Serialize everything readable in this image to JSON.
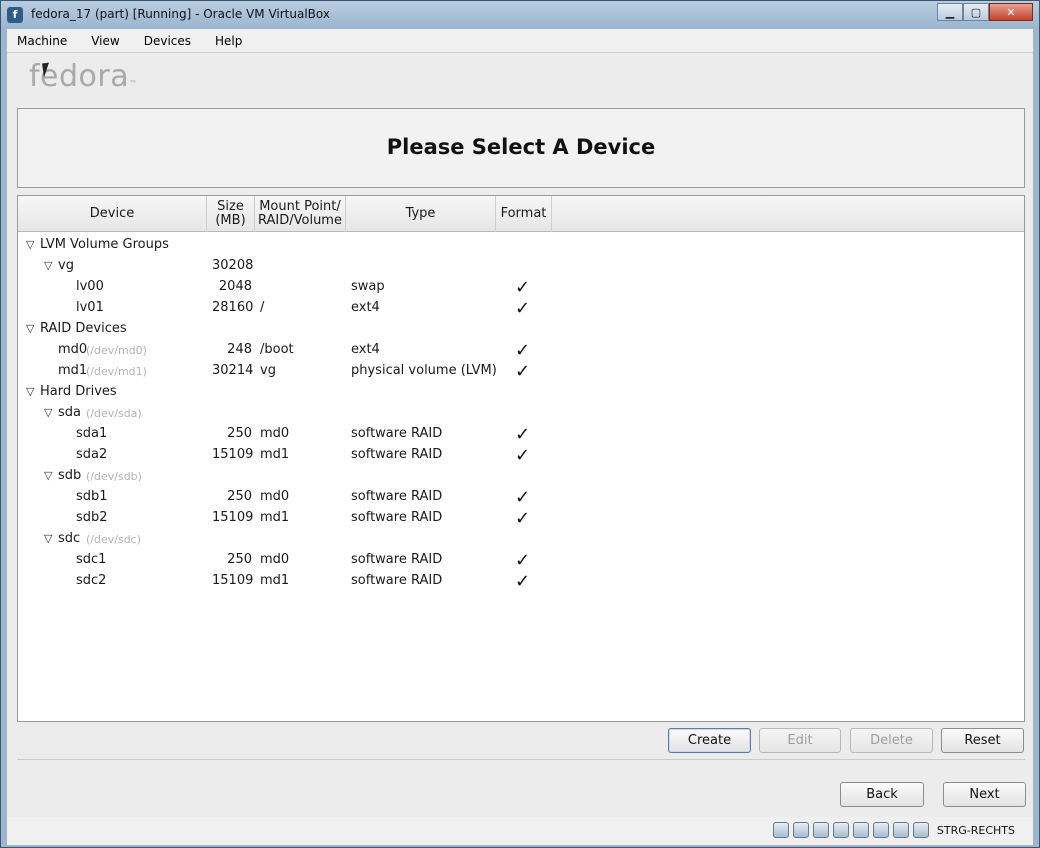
{
  "window": {
    "title": "fedora_17 (part) [Running] - Oracle VM VirtualBox"
  },
  "menu": [
    "Machine",
    "View",
    "Devices",
    "Help"
  ],
  "logo": "fedora",
  "header": {
    "title": "Please Select A Device"
  },
  "columns": {
    "device": "Device",
    "size": "Size\n(MB)",
    "mount": "Mount Point/\nRAID/Volume",
    "type": "Type",
    "format": "Format"
  },
  "rows": [
    {
      "level": 0,
      "expander": true,
      "device": "LVM Volume Groups",
      "path": "",
      "size": "",
      "mount": "",
      "type": "",
      "format": false
    },
    {
      "level": 1,
      "expander": true,
      "device": "vg",
      "path": "",
      "size": "30208",
      "mount": "",
      "type": "",
      "format": false
    },
    {
      "level": 2,
      "expander": false,
      "device": "lv00",
      "path": "",
      "size": "2048",
      "mount": "",
      "type": "swap",
      "format": true
    },
    {
      "level": 2,
      "expander": false,
      "device": "lv01",
      "path": "",
      "size": "28160",
      "mount": "/",
      "type": "ext4",
      "format": true
    },
    {
      "level": 0,
      "expander": true,
      "device": "RAID Devices",
      "path": "",
      "size": "",
      "mount": "",
      "type": "",
      "format": false
    },
    {
      "level": 1,
      "expander": false,
      "device": "md0",
      "path": "(/dev/md0)",
      "size": "248",
      "mount": "/boot",
      "type": "ext4",
      "format": true
    },
    {
      "level": 1,
      "expander": false,
      "device": "md1",
      "path": "(/dev/md1)",
      "size": "30214",
      "mount": "vg",
      "type": "physical volume (LVM)",
      "format": true
    },
    {
      "level": 0,
      "expander": true,
      "device": "Hard Drives",
      "path": "",
      "size": "",
      "mount": "",
      "type": "",
      "format": false
    },
    {
      "level": 1,
      "expander": true,
      "device": "sda",
      "path": "(/dev/sda)",
      "size": "",
      "mount": "",
      "type": "",
      "format": false
    },
    {
      "level": 2,
      "expander": false,
      "device": "sda1",
      "path": "",
      "size": "250",
      "mount": "md0",
      "type": "software RAID",
      "format": true
    },
    {
      "level": 2,
      "expander": false,
      "device": "sda2",
      "path": "",
      "size": "15109",
      "mount": "md1",
      "type": "software RAID",
      "format": true
    },
    {
      "level": 1,
      "expander": true,
      "device": "sdb",
      "path": "(/dev/sdb)",
      "size": "",
      "mount": "",
      "type": "",
      "format": false
    },
    {
      "level": 2,
      "expander": false,
      "device": "sdb1",
      "path": "",
      "size": "250",
      "mount": "md0",
      "type": "software RAID",
      "format": true
    },
    {
      "level": 2,
      "expander": false,
      "device": "sdb2",
      "path": "",
      "size": "15109",
      "mount": "md1",
      "type": "software RAID",
      "format": true
    },
    {
      "level": 1,
      "expander": true,
      "device": "sdc",
      "path": "(/dev/sdc)",
      "size": "",
      "mount": "",
      "type": "",
      "format": false
    },
    {
      "level": 2,
      "expander": false,
      "device": "sdc1",
      "path": "",
      "size": "250",
      "mount": "md0",
      "type": "software RAID",
      "format": true
    },
    {
      "level": 2,
      "expander": false,
      "device": "sdc2",
      "path": "",
      "size": "15109",
      "mount": "md1",
      "type": "software RAID",
      "format": true
    }
  ],
  "buttons": {
    "create": "Create",
    "edit": "Edit",
    "delete": "Delete",
    "reset": "Reset",
    "back": "Back",
    "next": "Next"
  },
  "statusbar": {
    "host_key": "STRG-RECHTS",
    "icons": [
      "hard-disk-icon",
      "optical-drive-icon",
      "usb-icon",
      "network-icon",
      "shared-folder-icon",
      "display-icon",
      "mouse-integration-icon",
      "keyboard-capture-icon"
    ]
  }
}
